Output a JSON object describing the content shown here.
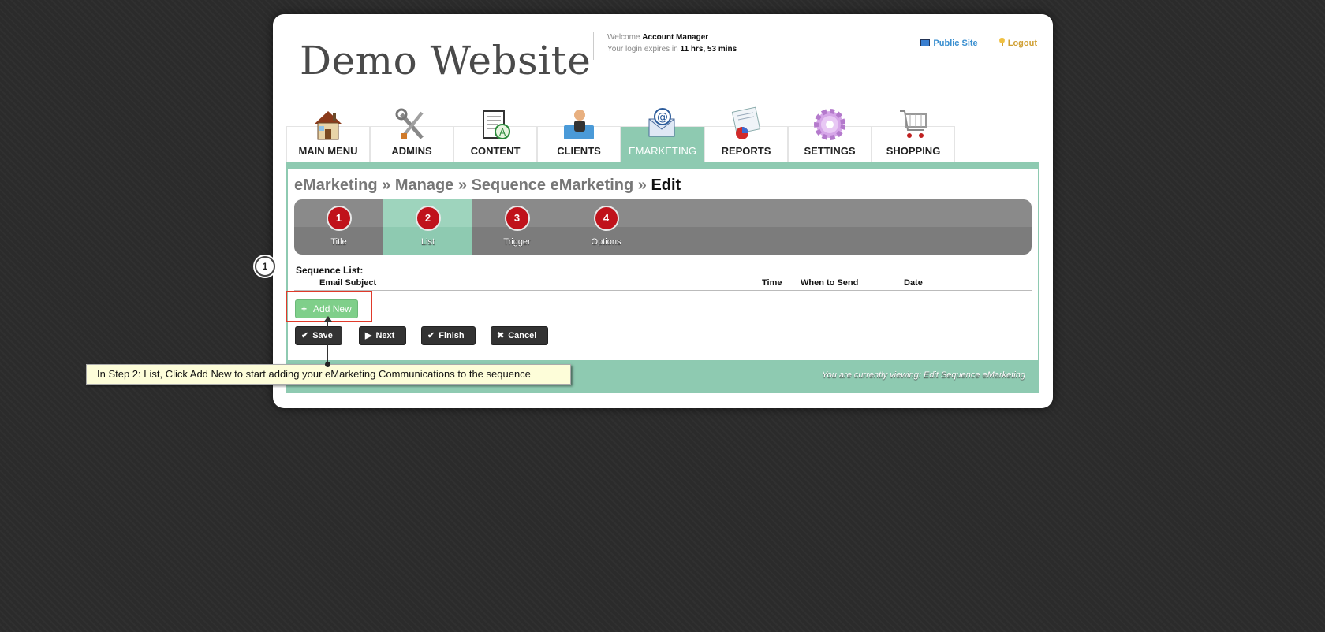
{
  "header": {
    "site_title": "Demo Website",
    "welcome_prefix": "Welcome",
    "user_name": "Account Manager",
    "expiry_prefix": "Your login expires in",
    "expiry_value": "11 hrs, 53 mins",
    "public_site_label": "Public Site",
    "logout_label": "Logout",
    "public_site_icon": "monitor-icon",
    "logout_icon": "key-icon"
  },
  "nav": {
    "tabs": [
      {
        "label": "MAIN MENU",
        "icon": "house-icon",
        "active": false
      },
      {
        "label": "ADMINS",
        "icon": "tools-icon",
        "active": false
      },
      {
        "label": "CONTENT",
        "icon": "document-icon",
        "active": false
      },
      {
        "label": "CLIENTS",
        "icon": "person-icon",
        "active": false
      },
      {
        "label": "EMARKETING",
        "icon": "email-icon",
        "active": true
      },
      {
        "label": "REPORTS",
        "icon": "report-icon",
        "active": false
      },
      {
        "label": "SETTINGS",
        "icon": "gear-icon",
        "active": false
      },
      {
        "label": "SHOPPING",
        "icon": "cart-icon",
        "active": false
      }
    ],
    "active_color": "#8ecab1"
  },
  "breadcrumb": {
    "part1": "eMarketing",
    "sep1": " » ",
    "part2": "Manage",
    "sep2": " » ",
    "part3": "Sequence eMarketing",
    "sep3": " » ",
    "current": "Edit"
  },
  "steps": [
    {
      "number": "1",
      "label": "Title",
      "active": false
    },
    {
      "number": "2",
      "label": "List",
      "active": true
    },
    {
      "number": "3",
      "label": "Trigger",
      "active": false
    },
    {
      "number": "4",
      "label": "Options",
      "active": false
    }
  ],
  "sequence_list": {
    "title": "Sequence List:",
    "columns": [
      "Email Subject",
      "Time",
      "When to Send",
      "Date"
    ],
    "add_new_label": "Add New"
  },
  "actions": {
    "save": "Save",
    "next": "Next",
    "finish": "Finish",
    "cancel": "Cancel"
  },
  "footer": {
    "viewing_text": "You are currently viewing: Edit Sequence eMarketing"
  },
  "tutorial": {
    "callout_number": "1",
    "tooltip_text": "In Step 2: List, Click Add New to start adding your eMarketing Communications to the sequence",
    "highlight_color": "#e03a2a"
  }
}
